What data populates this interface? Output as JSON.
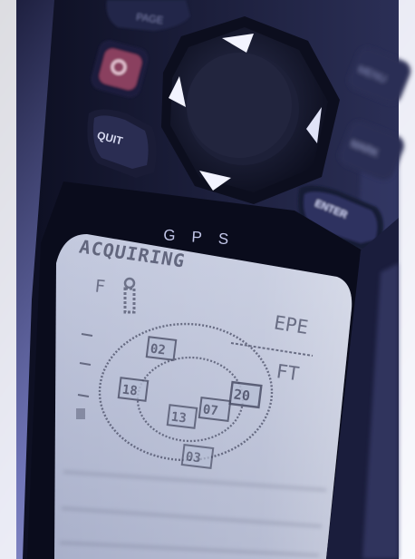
{
  "device": {
    "brand_label": "GPS",
    "buttons": {
      "quit": "QUIT",
      "enter": "ENTER",
      "page": "PAGE",
      "mark": "MARK",
      "menu": "MENU",
      "power": "power-icon"
    }
  },
  "screen": {
    "status_text": "ACQUIRING",
    "epe_label": "EPE",
    "unit_label": "FT",
    "flag_label": "F",
    "satellites": [
      "02",
      "18",
      "07",
      "20",
      "13",
      "03"
    ]
  },
  "colors": {
    "body_dark": "#14162e",
    "bezel": "#0e1024",
    "lcd_bg": "#b7bfd6",
    "lcd_ink": "#4a4e66",
    "background": "#cfd3f2"
  }
}
